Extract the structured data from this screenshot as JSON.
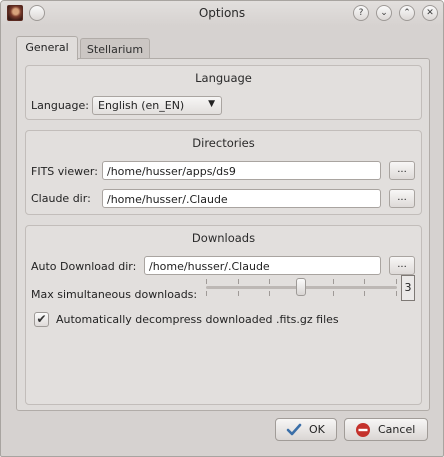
{
  "window": {
    "title": "Options",
    "controls": {
      "help": "?",
      "minimize": "⌄",
      "maximize": "⌃",
      "close": "✕"
    }
  },
  "tabs": [
    {
      "label": "General",
      "active": true
    },
    {
      "label": "Stellarium",
      "active": false
    }
  ],
  "language_group": {
    "title": "Language",
    "label": "Language:",
    "selected": "English (en_EN)"
  },
  "directories_group": {
    "title": "Directories",
    "fits_label": "FITS viewer:",
    "fits_value": "/home/husser/apps/ds9",
    "claude_label": "Claude dir:",
    "claude_value": "/home/husser/.Claude",
    "browse_label": "..."
  },
  "downloads_group": {
    "title": "Downloads",
    "auto_label": "Auto Download dir:",
    "auto_value": "/home/husser/.Claude",
    "browse_label": "...",
    "max_label": "Max simultaneous downloads:",
    "max_value": "3",
    "slider_value": 3,
    "slider_min": 0,
    "slider_max": 6,
    "decompress_label": "Automatically decompress downloaded .fits.gz files",
    "decompress_checked": true
  },
  "buttons": {
    "ok": "OK",
    "cancel": "Cancel"
  },
  "colors": {
    "window_bg": "#d6d2d0",
    "ok_icon": "#3b6fa8",
    "cancel_icon": "#c4322c"
  }
}
